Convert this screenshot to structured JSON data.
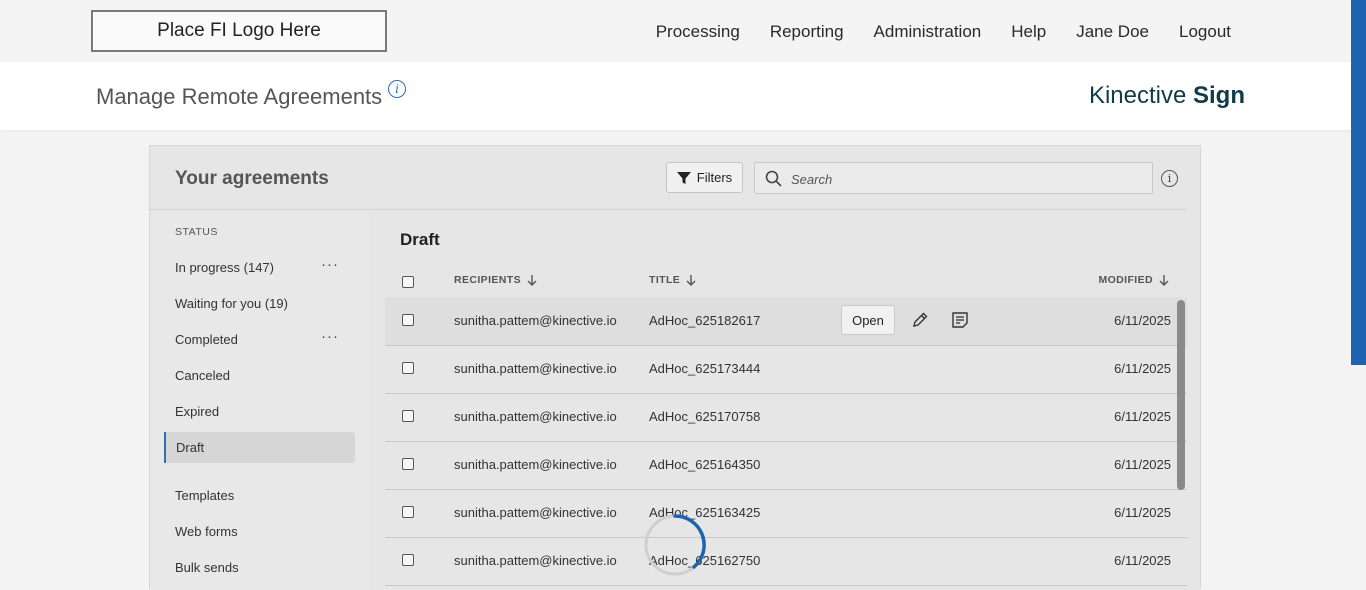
{
  "header": {
    "logo_text": "Place FI Logo Here",
    "nav": [
      "Processing",
      "Reporting",
      "Administration",
      "Help",
      "Jane Doe",
      "Logout"
    ]
  },
  "subheader": {
    "title": "Manage Remote Agreements",
    "brand_light": "Kinective",
    "brand_bold": "Sign"
  },
  "agreements": {
    "title": "Your agreements",
    "filters_label": "Filters",
    "search_placeholder": "Search"
  },
  "sidebar": {
    "status_label": "STATUS",
    "items": [
      {
        "label": "In progress (147)",
        "more": "···"
      },
      {
        "label": "Waiting for you (19)"
      },
      {
        "label": "Completed",
        "more": "···"
      },
      {
        "label": "Canceled"
      },
      {
        "label": "Expired"
      },
      {
        "label": "Draft",
        "active": true
      },
      {
        "label": "Templates"
      },
      {
        "label": "Web forms"
      },
      {
        "label": "Bulk sends"
      }
    ]
  },
  "table": {
    "section_title": "Draft",
    "columns": {
      "recipients": "RECIPIENTS",
      "title": "TITLE",
      "modified": "MODIFIED"
    },
    "open_label": "Open",
    "rows": [
      {
        "recipient": "sunitha.pattem@kinective.io",
        "title": "AdHoc_625182617",
        "modified": "6/11/2025"
      },
      {
        "recipient": "sunitha.pattem@kinective.io",
        "title": "AdHoc_625173444",
        "modified": "6/11/2025"
      },
      {
        "recipient": "sunitha.pattem@kinective.io",
        "title": "AdHoc_625170758",
        "modified": "6/11/2025"
      },
      {
        "recipient": "sunitha.pattem@kinective.io",
        "title": "AdHoc_625164350",
        "modified": "6/11/2025"
      },
      {
        "recipient": "sunitha.pattem@kinective.io",
        "title": "AdHoc_625163425",
        "modified": "6/11/2025"
      },
      {
        "recipient": "sunitha.pattem@kinective.io",
        "title": "AdHoc_625162750",
        "modified": "6/11/2025"
      }
    ]
  },
  "colors": {
    "accent": "#2f6fb5",
    "brand": "#0f3c48",
    "scroll_accent": "#1e63b0"
  }
}
